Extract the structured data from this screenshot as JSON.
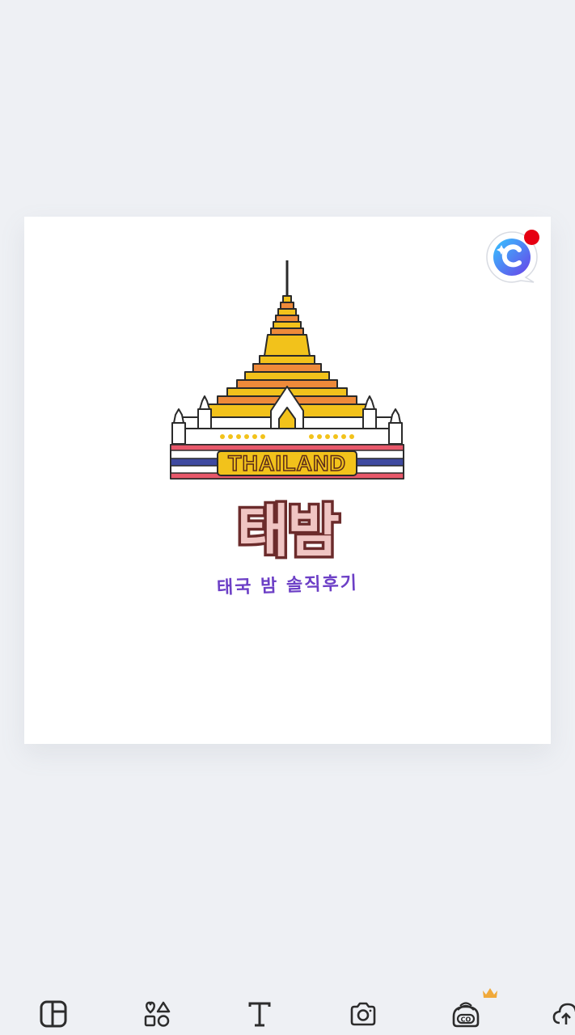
{
  "canvas": {
    "logo_text": "THAILAND",
    "title": "태밤",
    "subtitle": "태국 밤 솔직후기"
  },
  "ai_badge": {
    "icon": "ai-assistant-c-icon",
    "notification_dot_color": "#e60012"
  },
  "toolbar": {
    "items": [
      {
        "icon": "layout-icon"
      },
      {
        "icon": "elements-icon"
      },
      {
        "icon": "text-icon"
      },
      {
        "icon": "camera-icon"
      },
      {
        "icon": "sticker-icon",
        "premium": true
      },
      {
        "icon": "cloud-icon"
      }
    ]
  },
  "colors": {
    "background": "#eef0f4",
    "title_fill": "#f0c5c3",
    "title_stroke": "#6b2b2b",
    "subtitle": "#6c3fc6",
    "temple_gold": "#f2c21b",
    "temple_orange": "#ee8a3a",
    "flag_red": "#e8586a",
    "flag_blue": "#3f4aa0",
    "premium_crown": "#f0a93a"
  }
}
